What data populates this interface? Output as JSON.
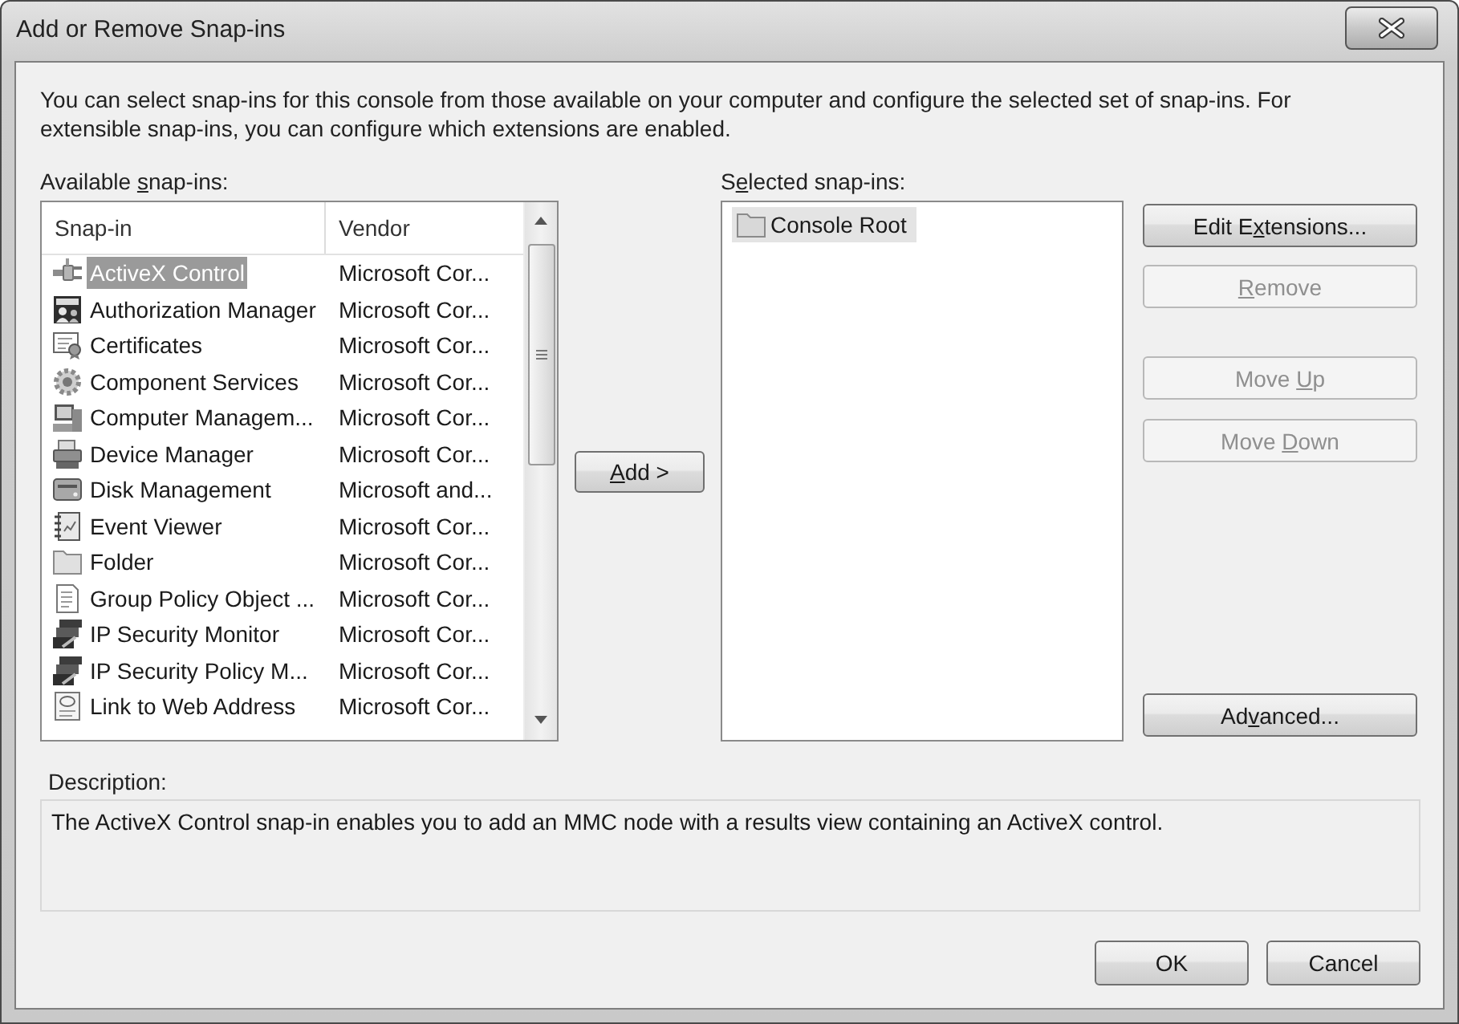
{
  "window": {
    "title": "Add or Remove Snap-ins"
  },
  "intro": "You can select snap-ins for this console from those available on your computer and configure the selected set of snap-ins. For extensible snap-ins, you can configure which extensions are enabled.",
  "available_snapins": {
    "label": "Available snap-ins:",
    "columns": [
      {
        "label": "Snap-in"
      },
      {
        "label": "Vendor"
      }
    ],
    "rows": [
      {
        "name": "ActiveX Control",
        "vendor": "Microsoft Cor...",
        "selected": true
      },
      {
        "name": "Authorization Manager",
        "vendor": "Microsoft Cor...",
        "selected": false
      },
      {
        "name": "Certificates",
        "vendor": "Microsoft Cor...",
        "selected": false
      },
      {
        "name": "Component Services",
        "vendor": "Microsoft Cor...",
        "selected": false
      },
      {
        "name": "Computer Managem...",
        "vendor": "Microsoft Cor...",
        "selected": false
      },
      {
        "name": "Device Manager",
        "vendor": "Microsoft Cor...",
        "selected": false
      },
      {
        "name": "Disk Management",
        "vendor": "Microsoft and...",
        "selected": false
      },
      {
        "name": "Event Viewer",
        "vendor": "Microsoft Cor...",
        "selected": false
      },
      {
        "name": "Folder",
        "vendor": "Microsoft Cor...",
        "selected": false
      },
      {
        "name": "Group Policy Object ...",
        "vendor": "Microsoft Cor...",
        "selected": false
      },
      {
        "name": "IP Security Monitor",
        "vendor": "Microsoft Cor...",
        "selected": false
      },
      {
        "name": "IP Security Policy M...",
        "vendor": "Microsoft Cor...",
        "selected": false
      },
      {
        "name": "Link to Web Address",
        "vendor": "Microsoft Cor...",
        "selected": false
      }
    ]
  },
  "add_button": {
    "label": "Add >"
  },
  "selected_snapins": {
    "label": "Selected snap-ins:",
    "items": [
      {
        "name": "Console Root",
        "selected": true
      }
    ]
  },
  "side_buttons": [
    {
      "label": "Edit Extensions...",
      "disabled": false
    },
    {
      "label": "Remove",
      "disabled": true
    },
    {
      "label": "Move Up",
      "disabled": true
    },
    {
      "label": "Move Down",
      "disabled": true
    },
    {
      "label": "Advanced...",
      "disabled": false
    }
  ],
  "description": {
    "label": "Description:",
    "text": "The ActiveX Control snap-in enables you to add an MMC node with a results view containing an ActiveX control."
  },
  "footer_buttons": [
    {
      "label": "OK"
    },
    {
      "label": "Cancel"
    }
  ]
}
